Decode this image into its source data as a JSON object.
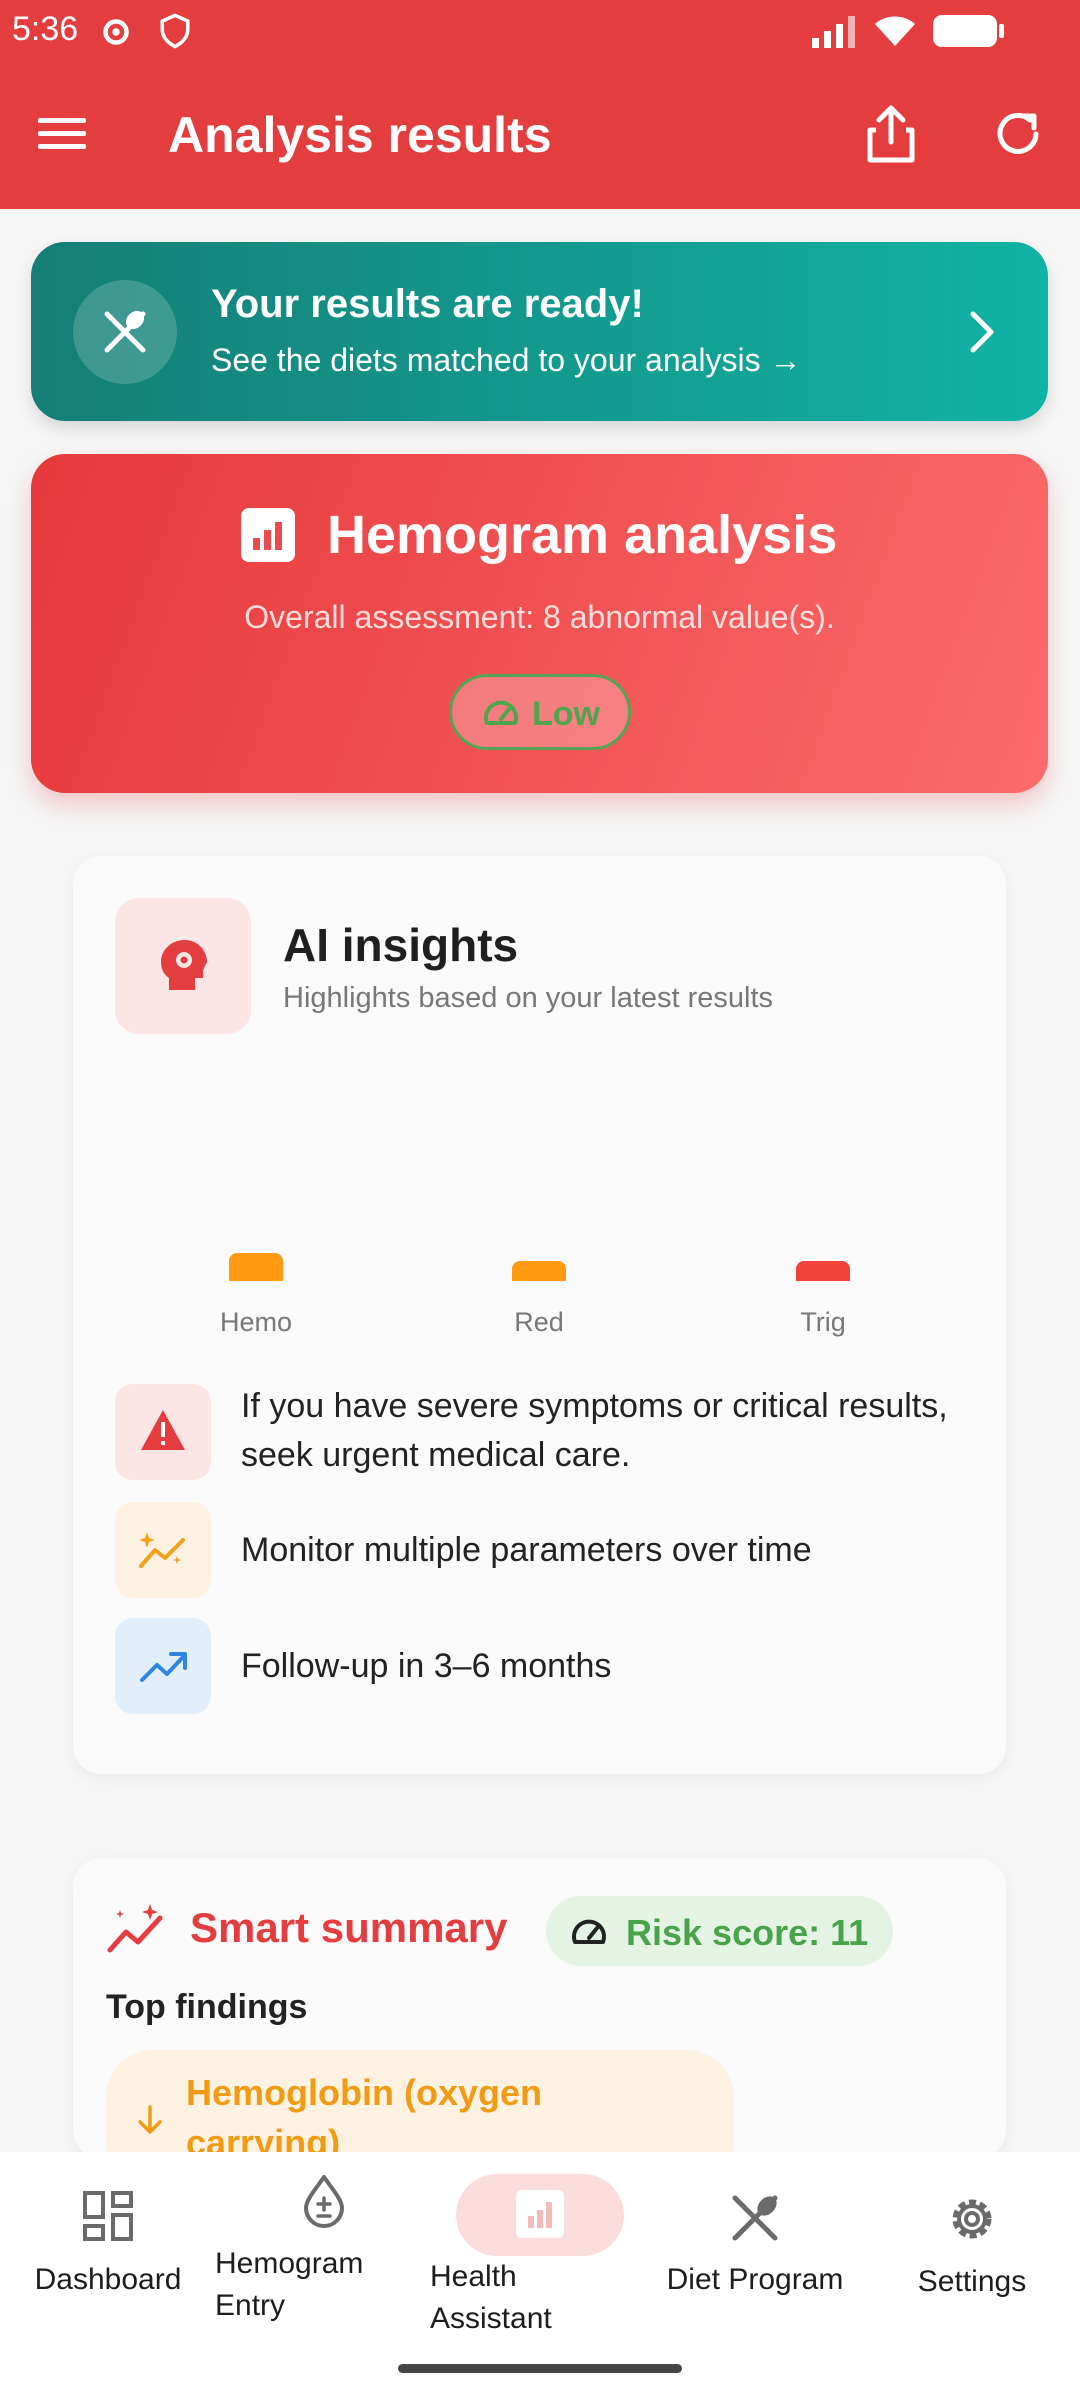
{
  "status": {
    "time": "5:36"
  },
  "appbar": {
    "title": "Analysis results"
  },
  "banner": {
    "title": "Your results are ready!",
    "subtitle": "See the diets matched to your analysis →"
  },
  "hemogram": {
    "title": "Hemogram analysis",
    "assessment": "Overall assessment: 8 abnormal value(s).",
    "badge": "Low"
  },
  "ai": {
    "title": "AI insights",
    "subtitle": "Highlights based on your latest results",
    "chart_data": {
      "type": "bar",
      "categories": [
        "Hemo",
        "Red",
        "Trig"
      ],
      "values": [
        0.1,
        0.07,
        0.07
      ],
      "colors": [
        "#ff9a12",
        "#ff9a12",
        "#f0443a"
      ]
    },
    "tips": [
      {
        "text": "If you have severe symptoms or critical results, seek urgent medical care.",
        "icon": "warning-icon"
      },
      {
        "text": "Monitor multiple parameters over time",
        "icon": "sparkle-trend-icon"
      },
      {
        "text": "Follow-up in 3–6 months",
        "icon": "trending-up-icon"
      }
    ]
  },
  "summary": {
    "title": "Smart summary",
    "risk": "Risk score: 11",
    "top_findings": "Top findings",
    "finding": "Hemoglobin (oxygen carrying)"
  },
  "nav": {
    "items": [
      {
        "label": "Dashboard"
      },
      {
        "label": "Hemogram Entry"
      },
      {
        "label": "Health Assistant"
      },
      {
        "label": "Diet Program"
      },
      {
        "label": "Settings"
      }
    ]
  }
}
